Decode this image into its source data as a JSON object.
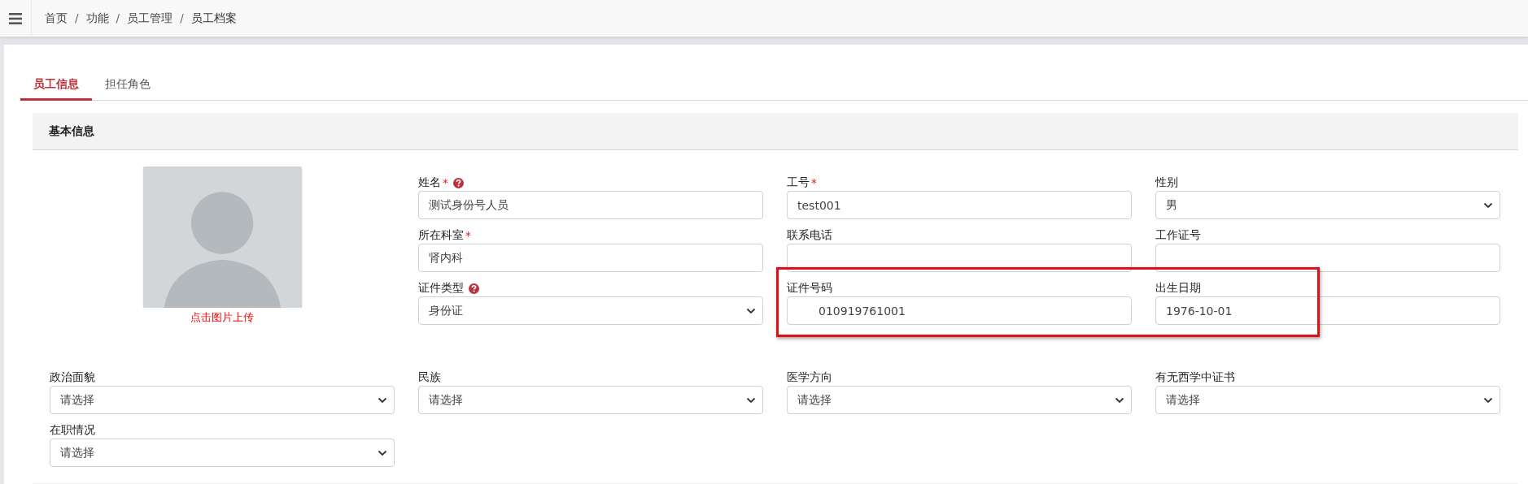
{
  "breadcrumb": [
    {
      "kind": "link",
      "label": "首页"
    },
    {
      "kind": "separator",
      "label": "/"
    },
    {
      "kind": "link",
      "label": "功能"
    },
    {
      "kind": "separator",
      "label": "/"
    },
    {
      "kind": "link",
      "label": "员工管理"
    },
    {
      "kind": "separator",
      "label": "/"
    },
    {
      "kind": "current",
      "label": "员工档案"
    }
  ],
  "tabs": [
    {
      "label": "员工信息",
      "selected": true
    },
    {
      "label": "担任角色",
      "selected": false
    }
  ],
  "section": {
    "title": "基本信息"
  },
  "photo": {
    "caption": "点击图片上传"
  },
  "fields": [
    {
      "label": "姓名",
      "required_mark": "*",
      "help": true,
      "kind": "text",
      "value": "测试身份号人员"
    },
    {
      "label": "工号",
      "required_mark": "*",
      "kind": "text",
      "value": "test001"
    },
    {
      "label": "性别",
      "kind": "select",
      "value": "男"
    },
    {
      "label": "所在科室",
      "required_mark": "*",
      "kind": "text",
      "value": "肾内科"
    },
    {
      "label": "联系电话",
      "kind": "text"
    },
    {
      "label": "工作证号",
      "kind": "text"
    },
    {
      "label": "证件类型",
      "help": true,
      "kind": "select",
      "value": "身份证"
    },
    {
      "label": "证件号码",
      "kind": "masked",
      "value": "010919761001",
      "highlighted": true
    },
    {
      "label": "出生日期",
      "kind": "text",
      "value": "1976-10-01",
      "highlighted": true
    }
  ],
  "more_fields": [
    {
      "label": "政治面貌",
      "kind": "select",
      "value": "请选择"
    },
    {
      "label": "民族",
      "kind": "select",
      "value": "请选择"
    },
    {
      "label": "医学方向",
      "kind": "select",
      "value": "请选择"
    },
    {
      "label": "有无西学中证书",
      "kind": "select",
      "value": "请选择"
    },
    {
      "label": "在职情况",
      "kind": "select",
      "value": "请选择"
    }
  ]
}
